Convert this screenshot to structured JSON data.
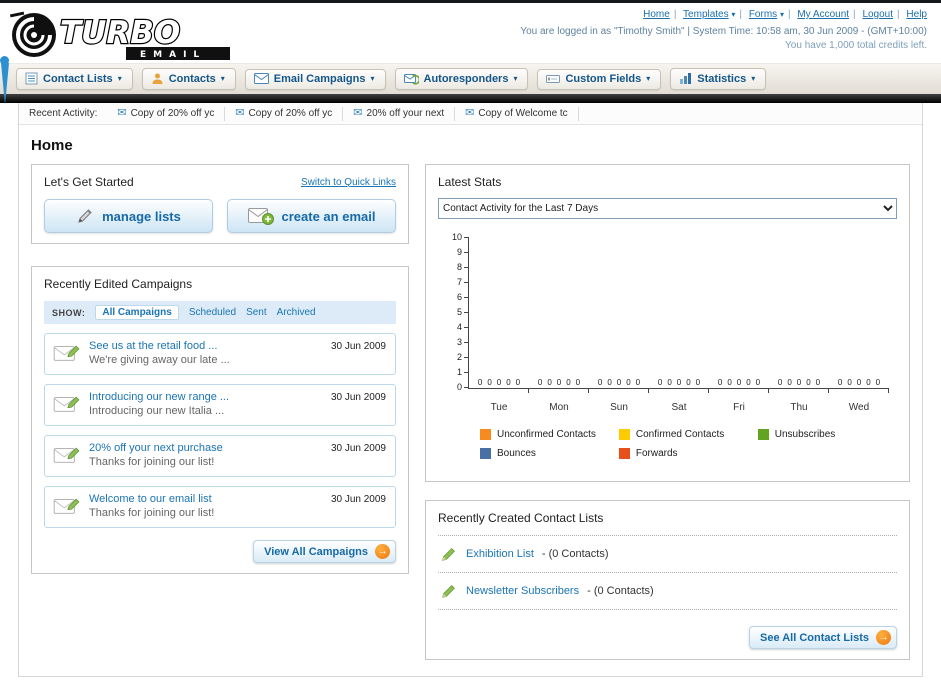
{
  "icons": {
    "caret": "▾",
    "envelope": "✉",
    "arrow": "→",
    "pipe": "|"
  },
  "header": {
    "logo_title": "TURBO",
    "logo_subtitle": "EMAIL",
    "links": [
      {
        "label": "Home",
        "dropdown": false
      },
      {
        "label": "Templates",
        "dropdown": true
      },
      {
        "label": "Forms",
        "dropdown": true
      },
      {
        "label": "My Account",
        "dropdown": false
      },
      {
        "label": "Logout",
        "dropdown": false
      },
      {
        "label": "Help",
        "dropdown": false
      }
    ],
    "login_info": "You are logged in as \"Timothy Smith\" | System Time: 10:58 am, 30 Jun 2009 - (GMT+10:00)",
    "credits": "You have 1,000 total credits left."
  },
  "nav": {
    "tabs": [
      {
        "label": "Contact Lists"
      },
      {
        "label": "Contacts"
      },
      {
        "label": "Email Campaigns"
      },
      {
        "label": "Autoresponders"
      },
      {
        "label": "Custom Fields"
      },
      {
        "label": "Statistics"
      }
    ]
  },
  "recent_activity": {
    "label": "Recent Activity:",
    "items": [
      "Copy of 20% off yc",
      "Copy of 20% off yc",
      "20% off your next",
      "Copy of Welcome tc"
    ]
  },
  "page_title": "Home",
  "get_started": {
    "title": "Let's Get Started",
    "switch_link": "Switch to Quick Links",
    "manage_lists_label": "manage lists",
    "create_email_label": "create an email"
  },
  "campaigns": {
    "title": "Recently Edited Campaigns",
    "show_label": "SHOW:",
    "tabs": [
      "All Campaigns",
      "Scheduled",
      "Sent",
      "Archived"
    ],
    "active_tab": "All Campaigns",
    "items": [
      {
        "title": "See us at the retail food ...",
        "subtitle": "We're giving away our late ...",
        "date": "30 Jun 2009"
      },
      {
        "title": "Introducing our new range ...",
        "subtitle": "Introducing our new Italia ...",
        "date": "30 Jun 2009"
      },
      {
        "title": "20% off your next purchase",
        "subtitle": "Thanks for joining our list!",
        "date": "30 Jun 2009"
      },
      {
        "title": "Welcome to our email list",
        "subtitle": "Thanks for joining our list!",
        "date": "30 Jun 2009"
      }
    ],
    "view_all_label": "View All Campaigns"
  },
  "stats": {
    "title": "Latest Stats",
    "selected_filter": "Contact Activity for the Last 7 Days",
    "chart_data": {
      "type": "bar",
      "title": "Contact Activity for the Last 7 Days",
      "categories": [
        "Tue",
        "Mon",
        "Sun",
        "Sat",
        "Fri",
        "Thu",
        "Wed"
      ],
      "series": [
        {
          "name": "Unconfirmed Contacts",
          "color": "#f68b1f",
          "values": [
            0,
            0,
            0,
            0,
            0,
            0,
            0
          ]
        },
        {
          "name": "Confirmed Contacts",
          "color": "#fecb00",
          "values": [
            0,
            0,
            0,
            0,
            0,
            0,
            0
          ]
        },
        {
          "name": "Unsubscribes",
          "color": "#62a420",
          "values": [
            0,
            0,
            0,
            0,
            0,
            0,
            0
          ]
        },
        {
          "name": "Bounces",
          "color": "#4a6fa5",
          "values": [
            0,
            0,
            0,
            0,
            0,
            0,
            0
          ]
        },
        {
          "name": "Forwards",
          "color": "#e8501b",
          "values": [
            0,
            0,
            0,
            0,
            0,
            0,
            0
          ]
        }
      ],
      "xlabel": "",
      "ylabel": "",
      "ylim": [
        0,
        10
      ],
      "ytick_step": 1,
      "grid": false,
      "legend_position": "bottom"
    }
  },
  "contact_lists": {
    "title": "Recently Created Contact Lists",
    "items": [
      {
        "name": "Exhibition List",
        "suffix": "- (0 Contacts)"
      },
      {
        "name": "Newsletter Subscribers",
        "suffix": "- (0 Contacts)"
      }
    ],
    "see_all_label": "See All Contact Lists"
  }
}
